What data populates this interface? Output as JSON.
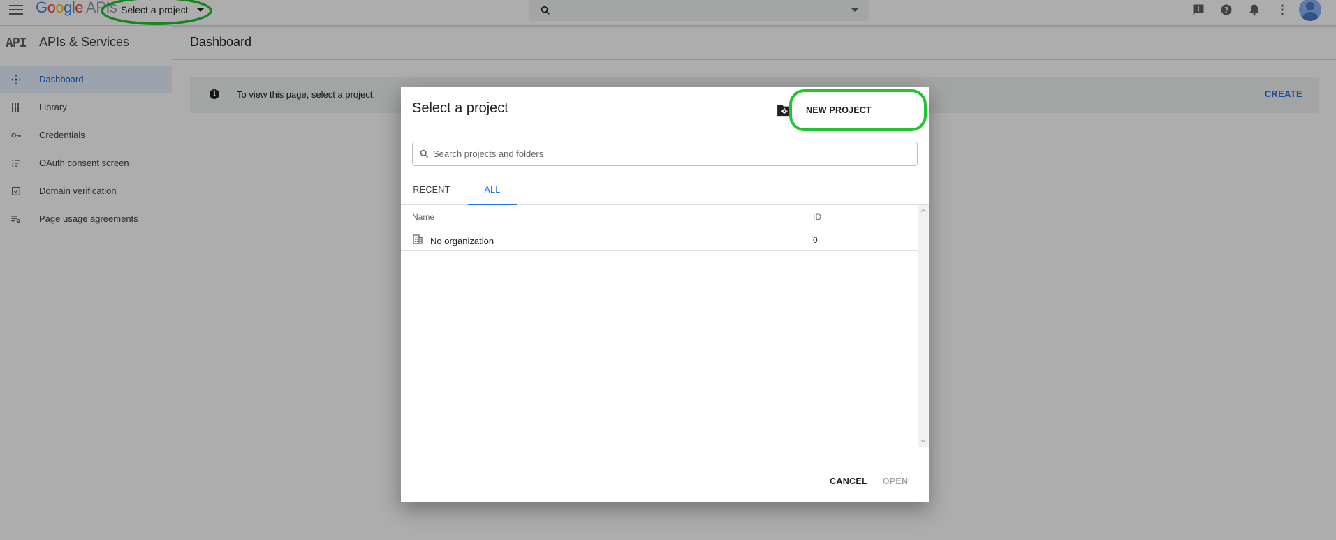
{
  "header": {
    "logo_letters": [
      "G",
      "o",
      "o",
      "g",
      "l",
      "e"
    ],
    "logo_suffix": "APIs",
    "project_selector_label": "Select a project",
    "search_placeholder": "",
    "icons": [
      "menu-icon",
      "search-icon",
      "chevron-down-icon",
      "feedback-icon",
      "help-icon",
      "notifications-icon",
      "more-vert-icon",
      "avatar"
    ]
  },
  "sidebar": {
    "logo": "API",
    "title": "APIs & Services",
    "items": [
      {
        "label": "Dashboard",
        "icon": "dashboard-icon",
        "active": true
      },
      {
        "label": "Library",
        "icon": "library-icon",
        "active": false
      },
      {
        "label": "Credentials",
        "icon": "key-icon",
        "active": false
      },
      {
        "label": "OAuth consent screen",
        "icon": "oauth-icon",
        "active": false
      },
      {
        "label": "Domain verification",
        "icon": "checkbox-icon",
        "active": false
      },
      {
        "label": "Page usage agreements",
        "icon": "settings-list-icon",
        "active": false
      }
    ]
  },
  "main": {
    "title": "Dashboard",
    "banner_message": "To view this page, select a project.",
    "banner_action": "CREATE"
  },
  "dialog": {
    "title": "Select a project",
    "new_project_label": "NEW PROJECT",
    "search_placeholder": "Search projects and folders",
    "tabs": [
      {
        "label": "RECENT",
        "active": false
      },
      {
        "label": "ALL",
        "active": true
      }
    ],
    "columns": {
      "name": "Name",
      "id": "ID"
    },
    "rows": [
      {
        "name": "No organization",
        "id": "0",
        "icon": "building-icon"
      }
    ],
    "cancel_label": "CANCEL",
    "open_label": "OPEN"
  },
  "colors": {
    "accent": "#1a73e8",
    "highlight": "#1fc52f",
    "active_nav_bg": "#e8f0fe"
  }
}
